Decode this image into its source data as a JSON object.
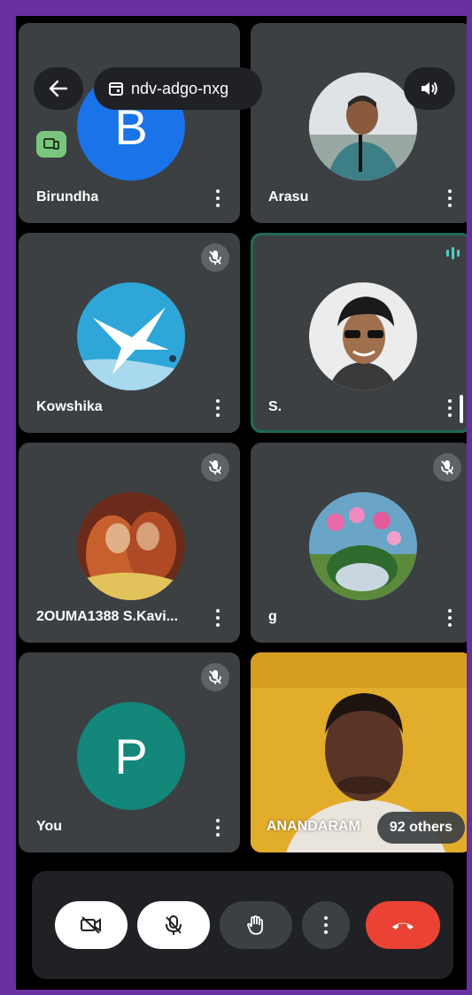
{
  "meeting": {
    "code": "ndv-adgo-nxg"
  },
  "tiles": [
    {
      "name": "Birundha",
      "initial": "B",
      "avatar_color": "#1a73e8",
      "muted": false
    },
    {
      "name": "Arasu",
      "muted": false
    },
    {
      "name": "Kowshika",
      "muted": true
    },
    {
      "name": "S.",
      "muted": false,
      "speaking": true
    },
    {
      "name": "2OUMA1388 S.Kavi...",
      "muted": true
    },
    {
      "name": "g",
      "muted": true
    },
    {
      "name": "You",
      "initial": "P",
      "avatar_color": "#12877a",
      "muted": true
    },
    {
      "name": "ANANDARAM",
      "others_label": "92 others"
    }
  ],
  "icons": {
    "back": "arrow-left-icon",
    "calendar": "calendar-icon",
    "speaker": "speaker-icon",
    "cast": "cast-icon",
    "audio_wave": "audio-wave-icon"
  },
  "colors": {
    "tile_bg": "#3c4043",
    "end_call": "#ea4335",
    "speaking_border": "#1e6b57",
    "frame": "#6a2fa0"
  }
}
